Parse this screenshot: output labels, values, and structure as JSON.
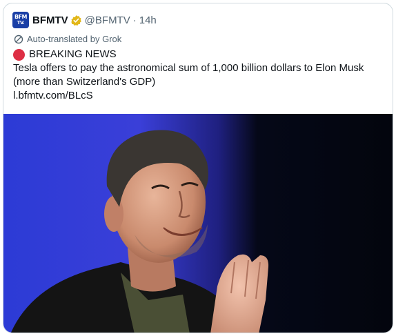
{
  "tweet": {
    "display_name": "BFMTV",
    "handle": "@BFMTV",
    "separator": "·",
    "time": "14h",
    "avatar_text_top": "BFM",
    "avatar_text_bottom": "TV.",
    "translation_note": "Auto-translated by Grok",
    "breaking_label": "BREAKING NEWS",
    "text_line_1": "Tesla offers to pay the astronomical sum of 1,000 billion dollars to Elon Musk",
    "text_line_2": "(more than Switzerland's GDP)",
    "link": "l.bfmtv.com/BLcS"
  },
  "icons": {
    "verified": "verified-gold-badge-icon",
    "translate": "translate-icon",
    "breaking": "red-circle-icon"
  },
  "colors": {
    "accent_red": "#dd2e44",
    "verified_gold": "#e2b719",
    "avatar_blue": "#1a3fa6",
    "secondary_text": "#536471",
    "border": "#cfd9de"
  }
}
